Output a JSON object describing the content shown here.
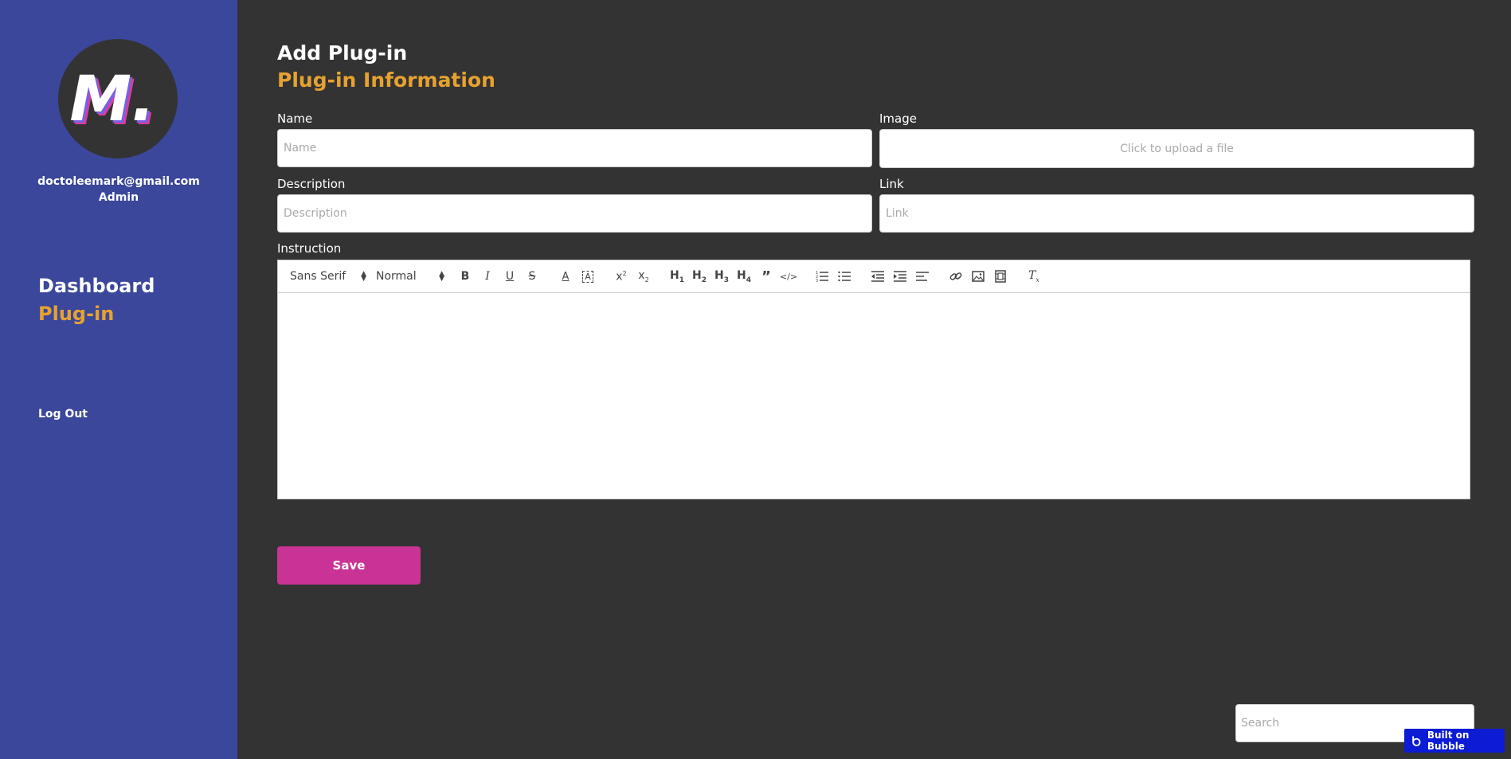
{
  "sidebar": {
    "logo_text": "M.",
    "user_email": "doctoleemark@gmail.com",
    "user_role": "Admin",
    "nav": {
      "dashboard": "Dashboard",
      "plugin": "Plug-in"
    },
    "logout": "Log Out"
  },
  "main": {
    "page_title": "Add Plug-in",
    "section_title": "Plug-in Information",
    "form": {
      "name_label": "Name",
      "name_placeholder": "Name",
      "image_label": "Image",
      "image_upload_text": "Click to upload a file",
      "description_label": "Description",
      "description_placeholder": "Description",
      "link_label": "Link",
      "link_placeholder": "Link",
      "instruction_label": "Instruction"
    },
    "editor": {
      "font_select": "Sans Serif",
      "size_select": "Normal",
      "buttons": [
        "bold",
        "italic",
        "underline",
        "strike",
        "text-color",
        "background-color",
        "superscript",
        "subscript",
        "h1",
        "h2",
        "h3",
        "h4",
        "blockquote",
        "code",
        "ordered-list",
        "bullet-list",
        "outdent",
        "indent",
        "align",
        "link",
        "image",
        "video",
        "clean"
      ]
    },
    "save_label": "Save"
  },
  "footer": {
    "search_placeholder": "Search",
    "badge_text": "Built on Bubble"
  },
  "colors": {
    "sidebar_bg": "#3a479b",
    "page_bg": "#333333",
    "accent_orange": "#e6a230",
    "save_button": "#c93395",
    "badge_bg": "#0c1bd4"
  }
}
